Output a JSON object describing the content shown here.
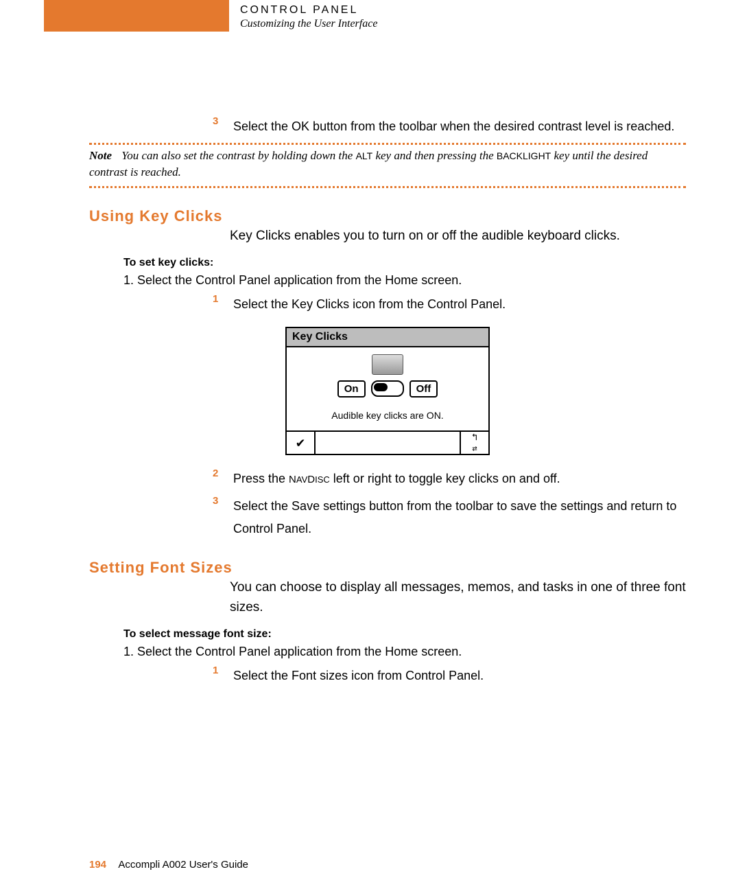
{
  "header": {
    "title": "CONTROL PANEL",
    "subtitle": "Customizing the User Interface"
  },
  "step3_top": {
    "num": "3",
    "text": "Select the OK button from the toolbar when the desired contrast level is reached."
  },
  "note": {
    "label": "Note",
    "pre": "You can also set the contrast by holding down the ",
    "alt": "ALT",
    "mid": " key and then pressing the ",
    "backlight": "BACKLIGHT",
    "post": " key until the desired contrast is reached."
  },
  "keyClicks": {
    "heading": "Using Key Clicks",
    "intro": "Key Clicks enables you to turn on or off the audible keyboard clicks.",
    "sub": "To set key clicks:",
    "step1_black": "1.   Select the Control Panel application from the Home screen.",
    "sub1": {
      "num": "1",
      "text": "Select the Key Clicks icon from the Control Panel."
    },
    "screenshot": {
      "title": "Key Clicks",
      "on": "On",
      "off": "Off",
      "status": "Audible key clicks are ON."
    },
    "sub2": {
      "num": "2",
      "pre": "Press the ",
      "nav": "NAVDISC",
      "post": " left or right to toggle key clicks on and off."
    },
    "sub3": {
      "num": "3",
      "text": "Select the Save settings button from the toolbar to save the settings and return to Control Panel."
    }
  },
  "fontSizes": {
    "heading": "Setting Font Sizes",
    "intro": "You can choose to display all messages, memos, and tasks in one of three font sizes.",
    "sub": "To select message font size:",
    "step1_black": "1.   Select the Control Panel application from the Home screen.",
    "sub1": {
      "num": "1",
      "text": "Select the Font sizes icon from Control Panel."
    }
  },
  "footer": {
    "page": "194",
    "guide": "Accompli A002 User's Guide"
  }
}
